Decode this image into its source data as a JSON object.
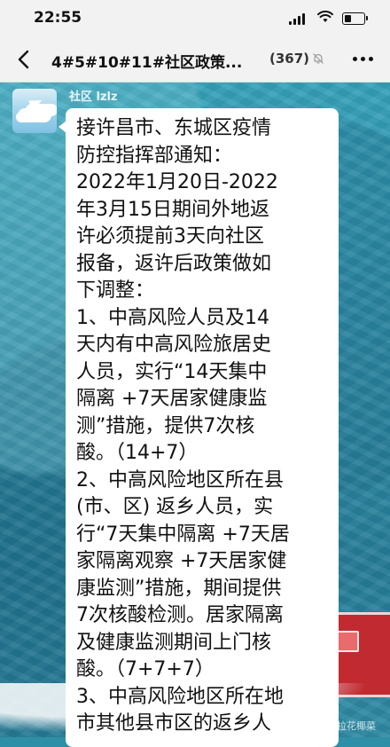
{
  "status_bar": {
    "time": "22:55",
    "battery_level": 0.35
  },
  "nav": {
    "title": "4#5#10#11#社区政策...",
    "member_count": "(367)",
    "icons": {
      "back": "chevron-left-icon",
      "mute": "mute-bell-icon",
      "more": "more-dots-icon"
    }
  },
  "message": {
    "sender": "社区 lzlz",
    "lines": [
      "接许昌市、东城区疫情",
      "防控指挥部通知：",
      "2022年1月20日-2022",
      "年3月15日期间外地返",
      "许必须提前3天向社区",
      "报备，返许后政策做如",
      "下调整：",
      "1、中高风险人员及14",
      "天内有中高风险旅居史",
      "人员，实行“14天集中",
      "隔离 +7天居家健康监",
      "测”措施，提供7次核",
      "酸。（14+7）",
      "2、中高风险地区所在县",
      "(市、区) 返乡人员，实",
      "行“7天集中隔离 +7天居",
      "家隔离观察 +7天居家健",
      "康监测”措施，期间提供",
      "7次核酸检测。居家隔离",
      "及健康监测期间上门核",
      "酸。（7+7+7）",
      "3、中高风险地区所在地",
      "市其他县市区的返乡人"
    ]
  },
  "watermark": "@西班巴拉花椰菜"
}
